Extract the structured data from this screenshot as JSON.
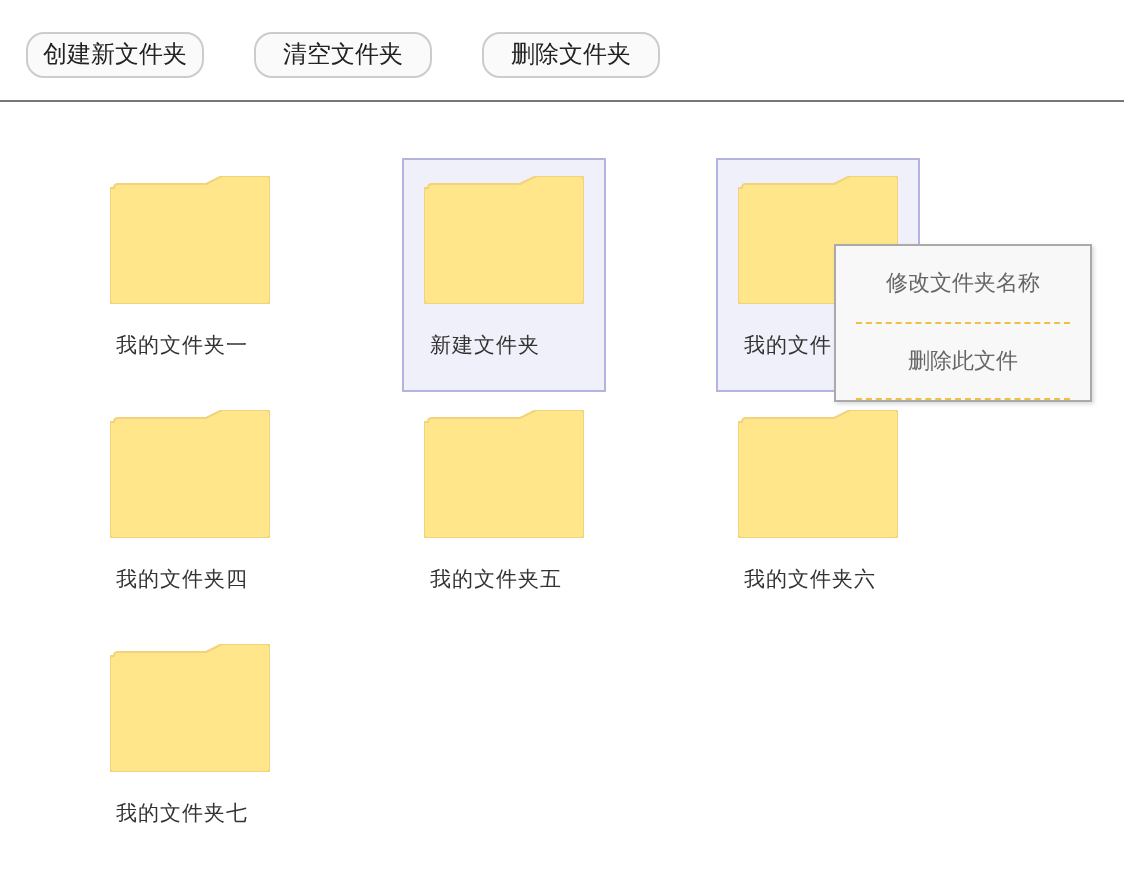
{
  "toolbar": {
    "buttons": [
      "创建新文件夹",
      "清空文件夹",
      "删除文件夹"
    ]
  },
  "folders": [
    {
      "name": "我的文件夹一",
      "selected": false
    },
    {
      "name": "新建文件夹",
      "selected": true
    },
    {
      "name": "我的文件",
      "selected": true
    },
    {
      "name": "我的文件夹四",
      "selected": false
    },
    {
      "name": "我的文件夹五",
      "selected": false
    },
    {
      "name": "我的文件夹六",
      "selected": false
    },
    {
      "name": "我的文件夹七",
      "selected": false
    }
  ],
  "context_menu": {
    "items": [
      "修改文件夹名称",
      "删除此文件"
    ]
  }
}
